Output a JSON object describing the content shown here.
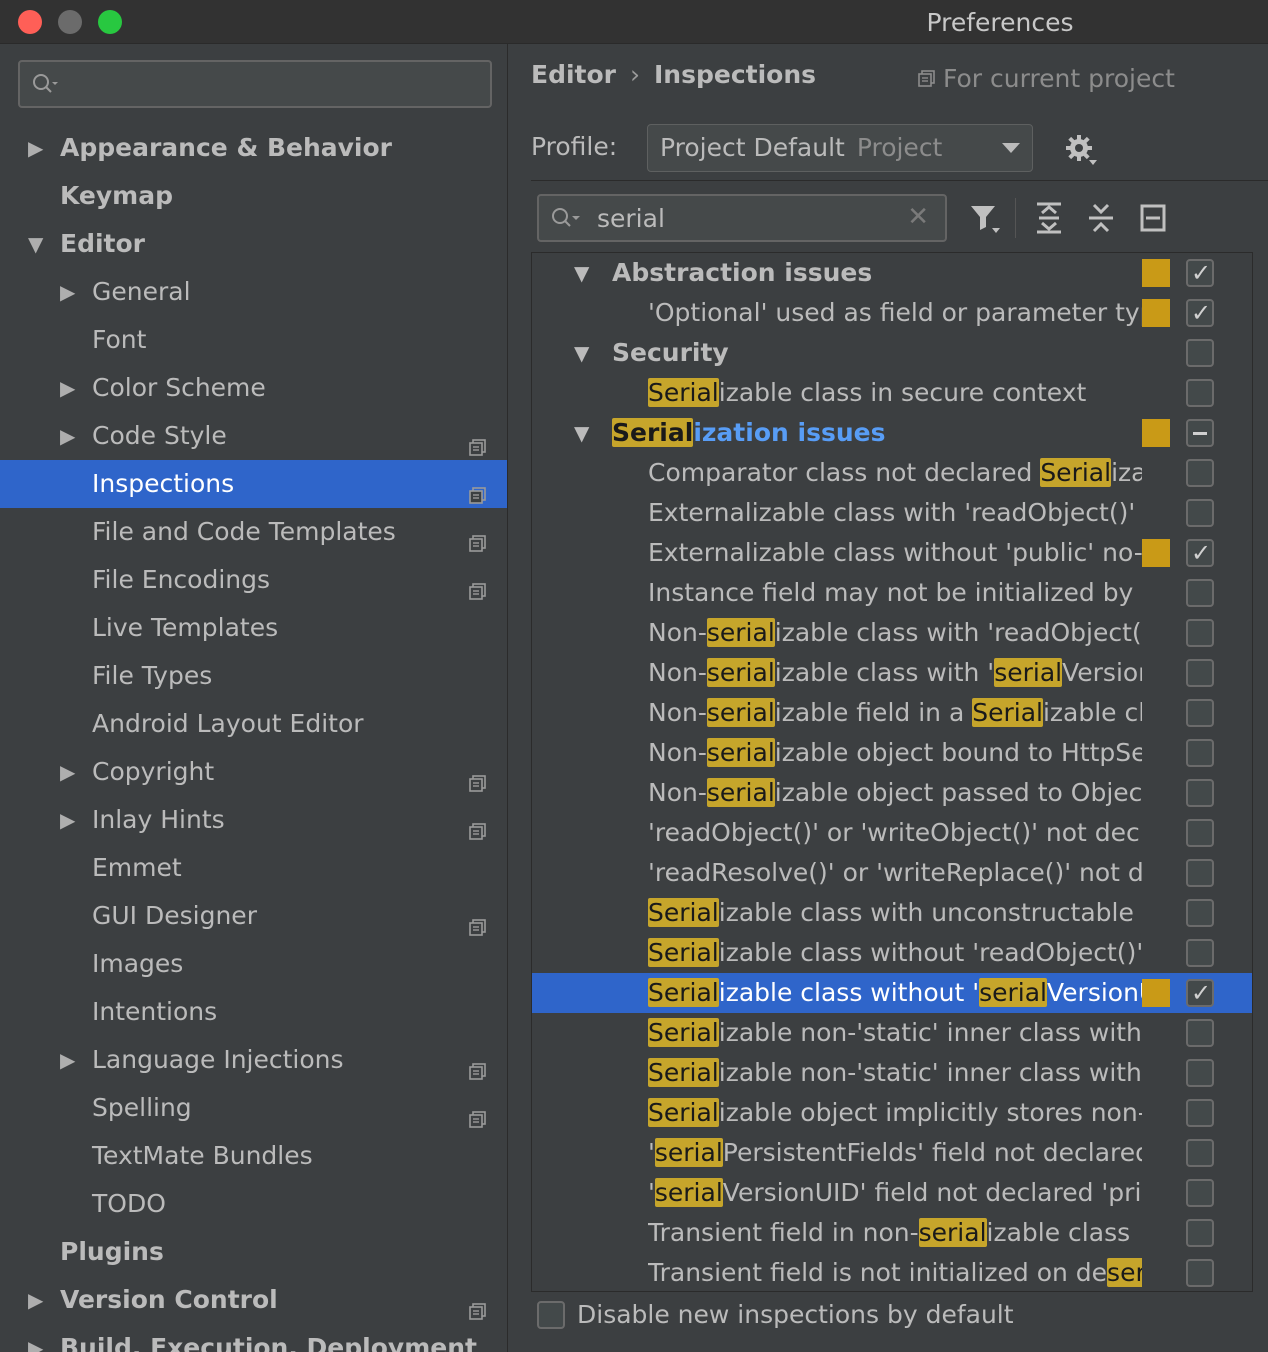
{
  "window": {
    "title": "Preferences"
  },
  "sidebar": {
    "search_placeholder": "",
    "items": [
      {
        "label": "Appearance & Behavior",
        "level": 0,
        "bold": true,
        "arrow": "right",
        "project_icon": false
      },
      {
        "label": "Keymap",
        "level": 0,
        "bold": true,
        "arrow": "",
        "project_icon": false
      },
      {
        "label": "Editor",
        "level": 0,
        "bold": true,
        "arrow": "down",
        "project_icon": false
      },
      {
        "label": "General",
        "level": 1,
        "arrow": "right",
        "project_icon": false
      },
      {
        "label": "Font",
        "level": 1,
        "arrow": "",
        "project_icon": false
      },
      {
        "label": "Color Scheme",
        "level": 1,
        "arrow": "right",
        "project_icon": false
      },
      {
        "label": "Code Style",
        "level": 1,
        "arrow": "right",
        "project_icon": true
      },
      {
        "label": "Inspections",
        "level": 1,
        "arrow": "",
        "project_icon": true,
        "selected": true
      },
      {
        "label": "File and Code Templates",
        "level": 1,
        "arrow": "",
        "project_icon": true
      },
      {
        "label": "File Encodings",
        "level": 1,
        "arrow": "",
        "project_icon": true
      },
      {
        "label": "Live Templates",
        "level": 1,
        "arrow": "",
        "project_icon": false
      },
      {
        "label": "File Types",
        "level": 1,
        "arrow": "",
        "project_icon": false
      },
      {
        "label": "Android Layout Editor",
        "level": 1,
        "arrow": "",
        "project_icon": false
      },
      {
        "label": "Copyright",
        "level": 1,
        "arrow": "right",
        "project_icon": true
      },
      {
        "label": "Inlay Hints",
        "level": 1,
        "arrow": "right",
        "project_icon": true
      },
      {
        "label": "Emmet",
        "level": 1,
        "arrow": "",
        "project_icon": false
      },
      {
        "label": "GUI Designer",
        "level": 1,
        "arrow": "",
        "project_icon": true
      },
      {
        "label": "Images",
        "level": 1,
        "arrow": "",
        "project_icon": false
      },
      {
        "label": "Intentions",
        "level": 1,
        "arrow": "",
        "project_icon": false
      },
      {
        "label": "Language Injections",
        "level": 1,
        "arrow": "right",
        "project_icon": true
      },
      {
        "label": "Spelling",
        "level": 1,
        "arrow": "",
        "project_icon": true
      },
      {
        "label": "TextMate Bundles",
        "level": 1,
        "arrow": "",
        "project_icon": false
      },
      {
        "label": "TODO",
        "level": 1,
        "arrow": "",
        "project_icon": false
      },
      {
        "label": "Plugins",
        "level": 0,
        "bold": true,
        "arrow": "",
        "project_icon": false
      },
      {
        "label": "Version Control",
        "level": 0,
        "bold": true,
        "arrow": "right",
        "project_icon": true
      },
      {
        "label": "Build, Execution, Deployment",
        "level": 0,
        "bold": true,
        "arrow": "right",
        "project_icon": false
      }
    ]
  },
  "main": {
    "breadcrumb": {
      "parent": "Editor",
      "separator": "›",
      "current": "Inspections"
    },
    "scope_note": "For current project",
    "profile": {
      "label": "Profile:",
      "value": "Project Default",
      "scope": "Project"
    },
    "filter": {
      "value": "serial"
    },
    "inspections": [
      {
        "kind": "group",
        "parts": [
          {
            "t": "Abstraction issues"
          }
        ],
        "severity": true,
        "check": "checked"
      },
      {
        "kind": "item",
        "parts": [
          {
            "t": "'Optional' used as field or parameter type"
          }
        ],
        "severity": true,
        "check": "checked"
      },
      {
        "kind": "group",
        "parts": [
          {
            "t": "Security"
          }
        ],
        "severity": false,
        "check": "unchecked"
      },
      {
        "kind": "item",
        "parts": [
          {
            "t": "Serial",
            "hl": true
          },
          {
            "t": "izable class in secure context"
          }
        ],
        "severity": false,
        "check": "unchecked"
      },
      {
        "kind": "group",
        "link": true,
        "parts": [
          {
            "t": "Serial",
            "hl": true
          },
          {
            "t": "ization issues"
          }
        ],
        "severity": true,
        "check": "indeterminate"
      },
      {
        "kind": "item",
        "parts": [
          {
            "t": "Comparator class not declared "
          },
          {
            "t": "Serial",
            "hl": true
          },
          {
            "t": "izable"
          }
        ],
        "severity": false,
        "check": "unchecked"
      },
      {
        "kind": "item",
        "parts": [
          {
            "t": "Externalizable class with 'readObject()' or 'writeObject()'"
          }
        ],
        "severity": false,
        "check": "unchecked"
      },
      {
        "kind": "item",
        "parts": [
          {
            "t": "Externalizable class without 'public' no-arg constructor"
          }
        ],
        "severity": true,
        "check": "checked"
      },
      {
        "kind": "item",
        "parts": [
          {
            "t": "Instance field may not be initialized by 'readObject()'"
          }
        ],
        "severity": false,
        "check": "unchecked"
      },
      {
        "kind": "item",
        "parts": [
          {
            "t": "Non-"
          },
          {
            "t": "serial",
            "hl": true
          },
          {
            "t": "izable class with 'readObject()' or 'writeObject()'"
          }
        ],
        "severity": false,
        "check": "unchecked"
      },
      {
        "kind": "item",
        "parts": [
          {
            "t": "Non-"
          },
          {
            "t": "serial",
            "hl": true
          },
          {
            "t": "izable class with '"
          },
          {
            "t": "serial",
            "hl": true
          },
          {
            "t": "VersionUID'"
          }
        ],
        "severity": false,
        "check": "unchecked"
      },
      {
        "kind": "item",
        "parts": [
          {
            "t": "Non-"
          },
          {
            "t": "serial",
            "hl": true
          },
          {
            "t": "izable field in a "
          },
          {
            "t": "Serial",
            "hl": true
          },
          {
            "t": "izable class"
          }
        ],
        "severity": false,
        "check": "unchecked"
      },
      {
        "kind": "item",
        "parts": [
          {
            "t": "Non-"
          },
          {
            "t": "serial",
            "hl": true
          },
          {
            "t": "izable object bound to HttpSession"
          }
        ],
        "severity": false,
        "check": "unchecked"
      },
      {
        "kind": "item",
        "parts": [
          {
            "t": "Non-"
          },
          {
            "t": "serial",
            "hl": true
          },
          {
            "t": "izable object passed to ObjectOutputStream"
          }
        ],
        "severity": false,
        "check": "unchecked"
      },
      {
        "kind": "item",
        "parts": [
          {
            "t": "'readObject()' or 'writeObject()' not declared 'private'"
          }
        ],
        "severity": false,
        "check": "unchecked"
      },
      {
        "kind": "item",
        "parts": [
          {
            "t": "'readResolve()' or 'writeReplace()' not declared 'protected'"
          }
        ],
        "severity": false,
        "check": "unchecked"
      },
      {
        "kind": "item",
        "parts": [
          {
            "t": "Serial",
            "hl": true
          },
          {
            "t": "izable class with unconstructable ancestor"
          }
        ],
        "severity": false,
        "check": "unchecked"
      },
      {
        "kind": "item",
        "parts": [
          {
            "t": "Serial",
            "hl": true
          },
          {
            "t": "izable class without 'readObject()' and 'writeObject()'"
          }
        ],
        "severity": false,
        "check": "unchecked"
      },
      {
        "kind": "item",
        "selected": true,
        "parts": [
          {
            "t": "Serial",
            "hl": true
          },
          {
            "t": "izable class without '"
          },
          {
            "t": "serial",
            "hl": true
          },
          {
            "t": "VersionUID'"
          }
        ],
        "severity": true,
        "check": "checked"
      },
      {
        "kind": "item",
        "parts": [
          {
            "t": "Serial",
            "hl": true
          },
          {
            "t": "izable non-'static' inner class with non-Serializable outer class"
          }
        ],
        "severity": false,
        "check": "unchecked"
      },
      {
        "kind": "item",
        "parts": [
          {
            "t": "Serial",
            "hl": true
          },
          {
            "t": "izable non-'static' inner class without 'serialVersionUID'"
          }
        ],
        "severity": false,
        "check": "unchecked"
      },
      {
        "kind": "item",
        "parts": [
          {
            "t": "Serial",
            "hl": true
          },
          {
            "t": "izable object implicitly stores non-Serializable object"
          }
        ],
        "severity": false,
        "check": "unchecked"
      },
      {
        "kind": "item",
        "parts": [
          {
            "t": "'"
          },
          {
            "t": "serial",
            "hl": true
          },
          {
            "t": "PersistentFields' field not declared 'private static final ObjectStreamField[]'"
          }
        ],
        "severity": false,
        "check": "unchecked"
      },
      {
        "kind": "item",
        "parts": [
          {
            "t": "'"
          },
          {
            "t": "serial",
            "hl": true
          },
          {
            "t": "VersionUID' field not declared 'private static final long'"
          }
        ],
        "severity": false,
        "check": "unchecked"
      },
      {
        "kind": "item",
        "parts": [
          {
            "t": "Transient field in non-"
          },
          {
            "t": "serial",
            "hl": true
          },
          {
            "t": "izable class"
          }
        ],
        "severity": false,
        "check": "unchecked"
      },
      {
        "kind": "item",
        "parts": [
          {
            "t": "Transient field is not initialized on de"
          },
          {
            "t": "serial",
            "hl": true
          },
          {
            "t": "ization"
          }
        ],
        "severity": false,
        "check": "unchecked"
      }
    ],
    "disable_new": {
      "label": "Disable new inspections by default",
      "checked": false
    }
  },
  "colors": {
    "selection": "#2f65ca",
    "highlight": "#c6a52b",
    "severity_warning": "#c99a17",
    "link": "#589df6"
  }
}
